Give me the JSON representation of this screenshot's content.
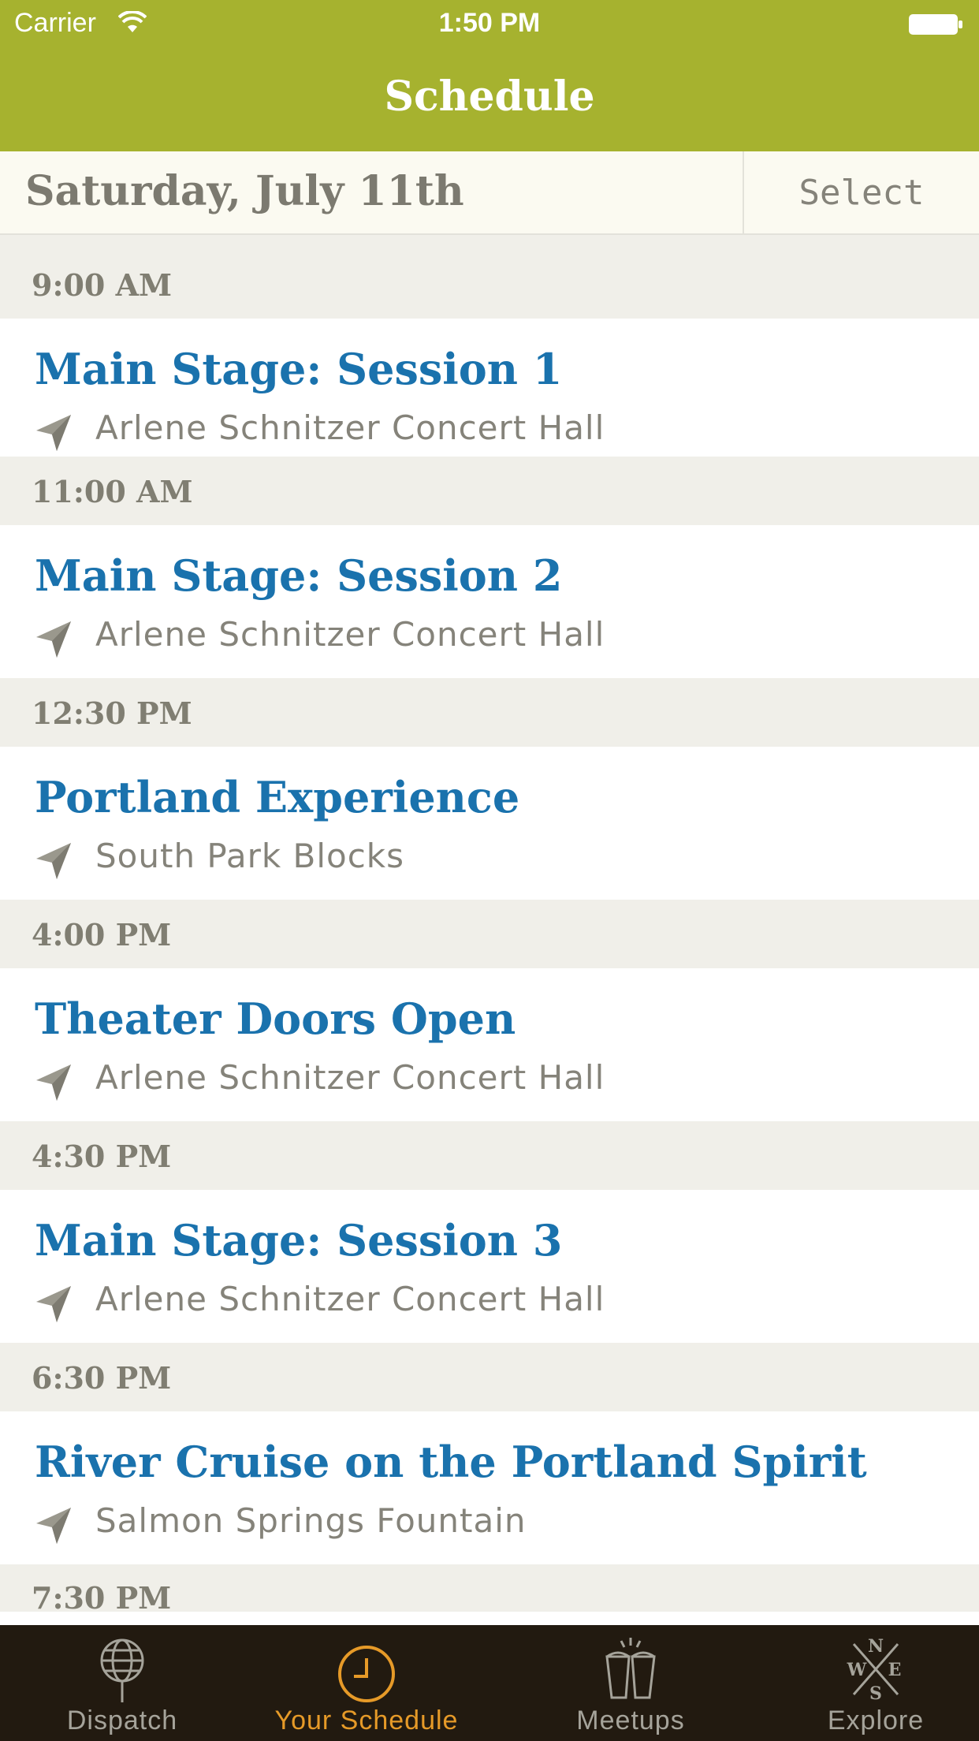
{
  "status_bar": {
    "carrier": "Carrier",
    "time": "1:50 PM"
  },
  "nav": {
    "title": "Schedule"
  },
  "date_bar": {
    "date": "Saturday, July 11th",
    "select_label": "Select"
  },
  "schedule": [
    {
      "time": "9:00 AM",
      "title": "Main Stage: Session 1",
      "location": "Arlene Schnitzer Concert Hall"
    },
    {
      "time": "11:00 AM",
      "title": "Main Stage: Session 2",
      "location": "Arlene Schnitzer Concert Hall"
    },
    {
      "time": "12:30 PM",
      "title": "Portland Experience",
      "location": "South Park Blocks"
    },
    {
      "time": "4:00 PM",
      "title": "Theater Doors Open",
      "location": "Arlene Schnitzer Concert Hall"
    },
    {
      "time": "4:30 PM",
      "title": "Main Stage: Session 3",
      "location": "Arlene Schnitzer Concert Hall"
    },
    {
      "time": "6:30 PM",
      "title": "River Cruise on the Portland Spirit",
      "location": "Salmon Springs Fountain"
    },
    {
      "time": "7:30 PM"
    }
  ],
  "tab_bar": {
    "tabs": [
      {
        "label": "Dispatch",
        "icon": "globe-icon",
        "active": false
      },
      {
        "label": "Your Schedule",
        "icon": "clock-icon",
        "active": true
      },
      {
        "label": "Meetups",
        "icon": "cups-icon",
        "active": false
      },
      {
        "label": "Explore",
        "icon": "compass-icon",
        "active": false
      }
    ]
  },
  "colors": {
    "header_bg": "#a6b22f",
    "event_title": "#1a72ad",
    "tab_active": "#e69a28",
    "tabbar_bg": "#221a10"
  }
}
